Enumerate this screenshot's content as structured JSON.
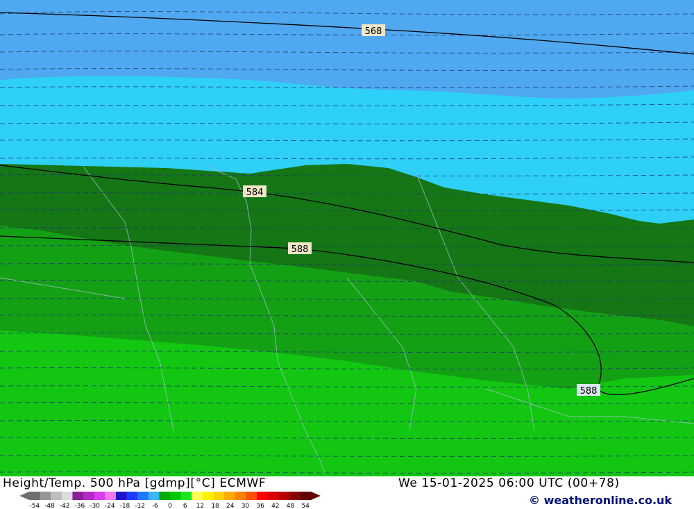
{
  "map": {
    "title": "Height/Temp. 500 hPa [gdmp][°C] ECMWF",
    "run_time": "We 15-01-2025 06:00 UTC (00+78)",
    "credit": "© weatheronline.co.uk",
    "credit_symbol": "©",
    "credit_site": "weatheronline.co.uk",
    "contour_labels": [
      "568",
      "584",
      "588",
      "588"
    ],
    "legend": {
      "labels": [
        "-54",
        "-48",
        "-42",
        "-36",
        "-30",
        "-24",
        "-18",
        "-12",
        "-6",
        "0",
        "6",
        "12",
        "18",
        "24",
        "30",
        "36",
        "42",
        "48",
        "54"
      ],
      "colors": [
        "#6e6e6e",
        "#969696",
        "#bebebe",
        "#dcdcdc",
        "#8c1e96",
        "#b428c8",
        "#dc3cf0",
        "#f078f0",
        "#1e14c8",
        "#1e3cff",
        "#1e78ff",
        "#3cb4ff",
        "#00aa00",
        "#00c800",
        "#1ee61e",
        "#ffff50",
        "#fff000",
        "#ffd200",
        "#ffaa00",
        "#ff8200",
        "#ff5000",
        "#ff0000",
        "#dc0000",
        "#b40000",
        "#8c0000",
        "#640000"
      ]
    },
    "colors": {
      "deep_blue": "#4fa8f0",
      "light_blue": "#2ed0f8",
      "dark_green": "#157615",
      "mid_green": "#14a014",
      "bright_green": "#12c612",
      "lime_green": "#20d820"
    }
  }
}
